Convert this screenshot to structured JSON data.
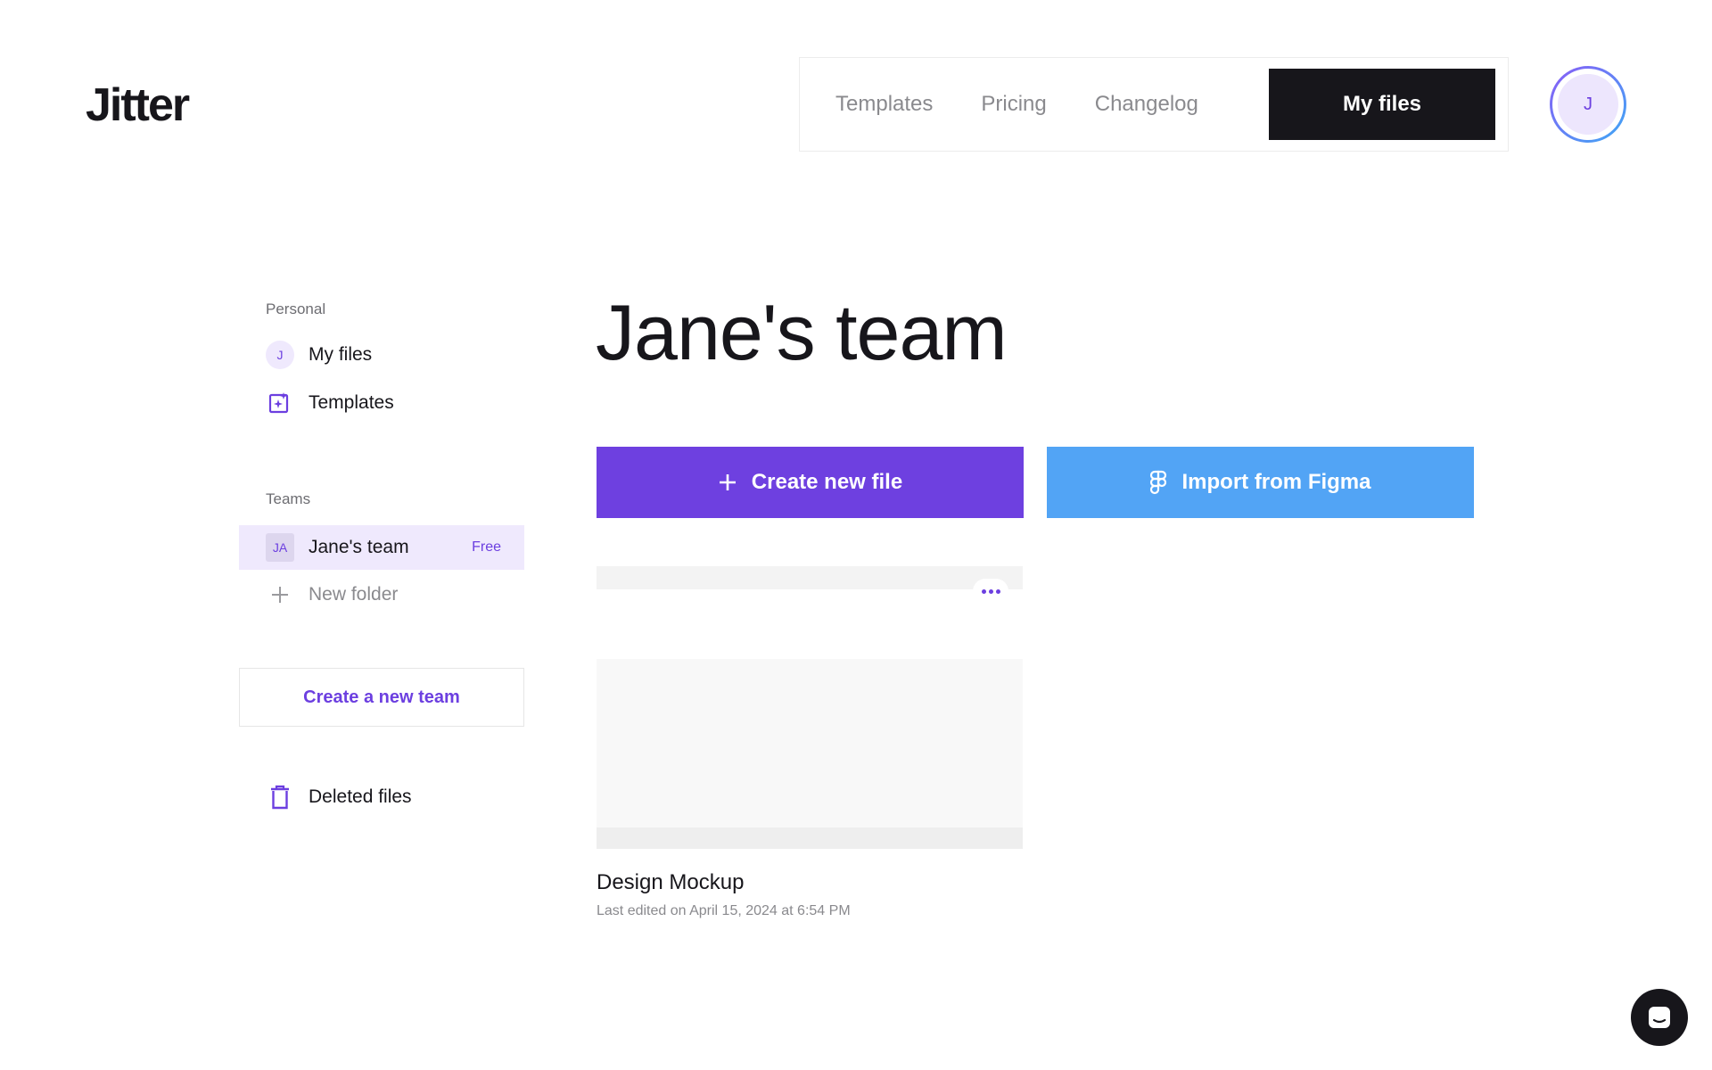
{
  "app": {
    "logo": "Jitter"
  },
  "topnav": {
    "links": [
      "Templates",
      "Pricing",
      "Changelog"
    ],
    "active_label": "My files",
    "avatar_initial": "J"
  },
  "sidebar": {
    "personal_label": "Personal",
    "my_files_initial": "J",
    "my_files": "My files",
    "templates": "Templates",
    "teams_label": "Teams",
    "team_initials": "JA",
    "team_name": "Jane's team",
    "team_plan": "Free",
    "new_folder": "New folder",
    "create_team": "Create a new team",
    "deleted_files": "Deleted files"
  },
  "main": {
    "title": "Jane's team",
    "create_button": "Create new file",
    "import_button": "Import from Figma",
    "file": {
      "name": "Design Mockup",
      "meta": "Last edited on April 15, 2024 at 6:54 PM"
    }
  },
  "colors": {
    "accent": "#6e40e0",
    "figma_blue": "#52a4f5",
    "dark": "#17161b"
  }
}
